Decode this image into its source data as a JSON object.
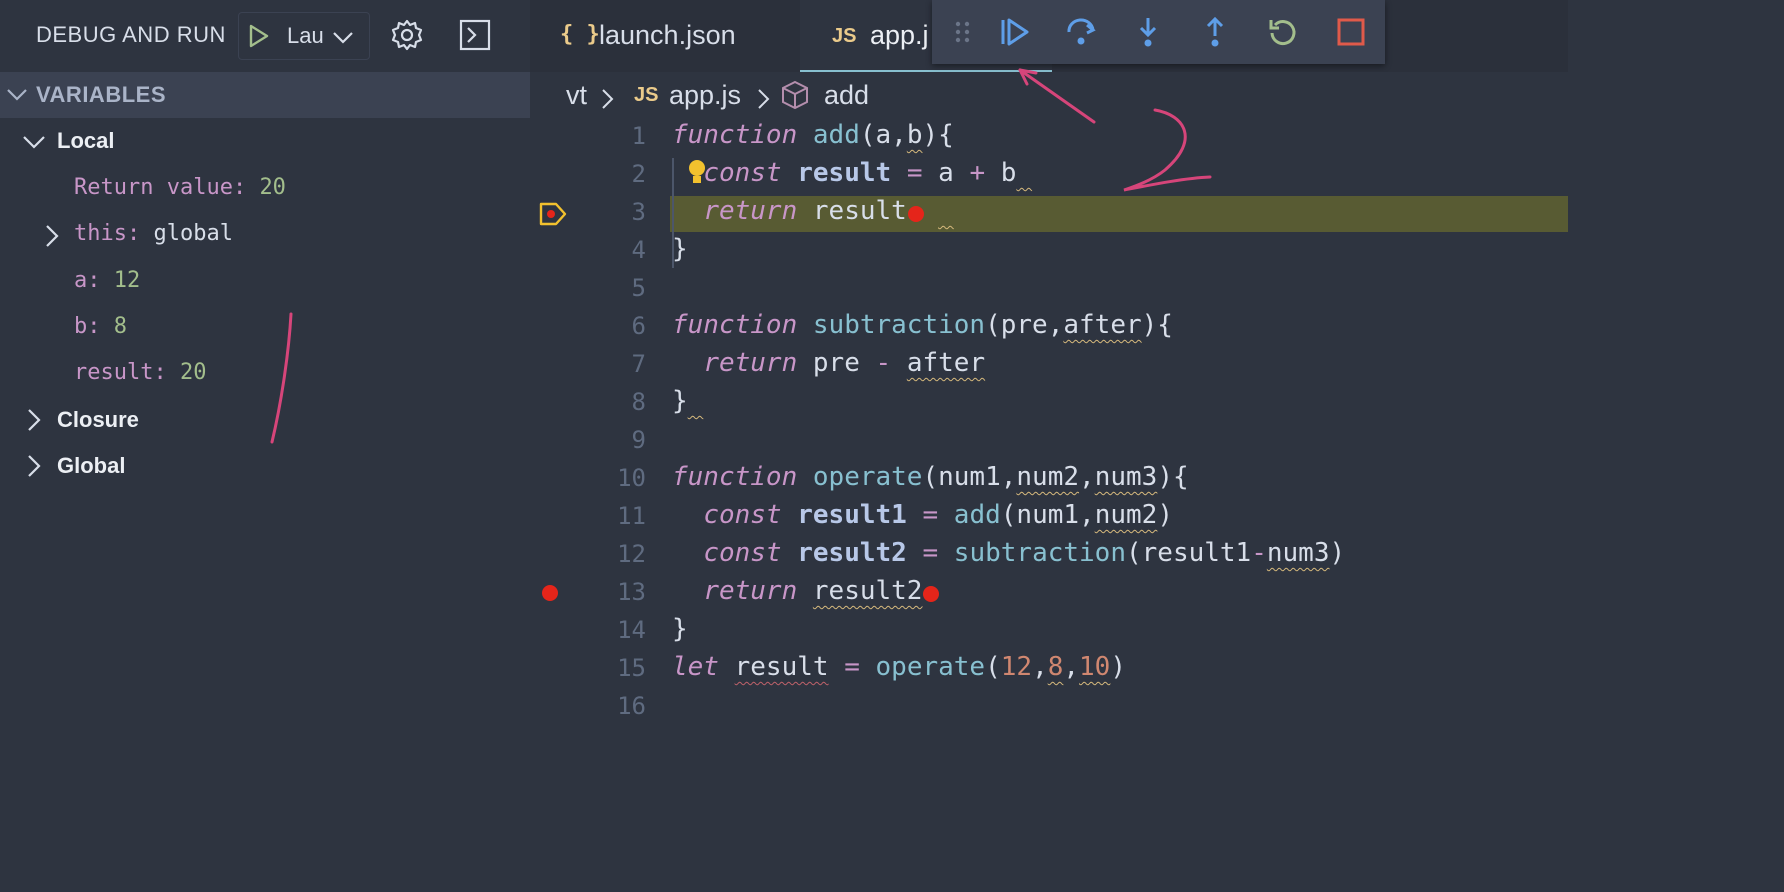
{
  "sidebar": {
    "title": "DEBUG AND RUN",
    "run_config_label": "Lau",
    "variables_header": "VARIABLES",
    "scopes": {
      "local": "Local",
      "closure": "Closure",
      "global": "Global"
    },
    "locals": {
      "return_name": "Return value:",
      "return_value": "20",
      "this_name": "this:",
      "this_value": "global",
      "a_name": "a:",
      "a_value": "12",
      "b_name": "b:",
      "b_value": "8",
      "result_name": "result:",
      "result_value": "20"
    }
  },
  "tabs": {
    "launch_icon": "{ }",
    "launch_label": "launch.json",
    "app_icon": "JS",
    "app_label": "app.j"
  },
  "breadcrumb": {
    "folder": "vt",
    "file_icon": "JS",
    "file": "app.js",
    "symbol": "add"
  },
  "editor": {
    "line_numbers": [
      "1",
      "2",
      "3",
      "4",
      "5",
      "6",
      "7",
      "8",
      "9",
      "10",
      "11",
      "12",
      "13",
      "14",
      "15",
      "16"
    ],
    "t": {
      "function": "function",
      "const": "const",
      "return": "return",
      "let": "let",
      "add": "add",
      "subtraction": "subtraction",
      "operate": "operate",
      "result": "result",
      "result1": "result1",
      "result2": "result2",
      "a": "a",
      "b": "b",
      "pre": "pre",
      "after": "after",
      "num1": "num1",
      "num2": "num2",
      "num3": "num3",
      "n12": "12",
      "n8": "8",
      "n10": "10"
    }
  },
  "colors": {
    "accent": "#88c0d0",
    "breakpoint": "#e5251a",
    "current_line": "#585b33",
    "annotation": "#d6457a"
  },
  "icons": {
    "run": "play-icon",
    "settings": "gear-icon",
    "terminal": "terminal-icon",
    "continue": "continue-icon",
    "step_over": "step-over-icon",
    "step_into": "step-into-icon",
    "step_out": "step-out-icon",
    "restart": "restart-icon",
    "stop": "stop-icon"
  }
}
